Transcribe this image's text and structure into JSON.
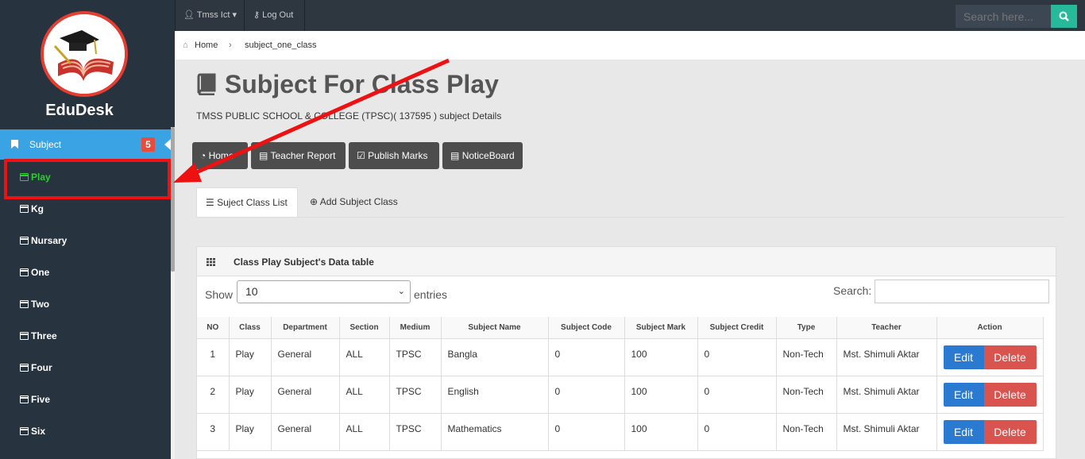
{
  "sidebar": {
    "brand": "EduDesk",
    "active_item": {
      "label": "Subject",
      "badge": "5"
    },
    "items": [
      {
        "label": "Play",
        "selected": true
      },
      {
        "label": "Kg"
      },
      {
        "label": "Nursary"
      },
      {
        "label": "One"
      },
      {
        "label": "Two"
      },
      {
        "label": "Three"
      },
      {
        "label": "Four"
      },
      {
        "label": "Five"
      },
      {
        "label": "Six"
      }
    ]
  },
  "topbar": {
    "user": "Tmss Ict",
    "logout": "Log Out",
    "search_placeholder": "Search here..."
  },
  "breadcrumb": {
    "home": "Home",
    "current": "subject_one_class"
  },
  "page": {
    "title": "Subject For Class Play",
    "subtitle": "TMSS PUBLIC SCHOOL & COLLEGE (TPSC)( 137595 ) subject Details"
  },
  "quick_buttons": {
    "home": "Home",
    "teacher_report": "Teacher Report",
    "publish_marks": "Publish Marks",
    "noticeboard": "NoticeBoard"
  },
  "tabs": {
    "list": "Suject Class List",
    "add": "Add Subject Class"
  },
  "panel": {
    "title": "Class Play Subject's Data table",
    "show_label": "Show",
    "page_size": "10",
    "entries_label": "entries",
    "search_label": "Search:"
  },
  "table": {
    "headers": [
      "NO",
      "Class",
      "Department",
      "Section",
      "Medium",
      "Subject Name",
      "Subject Code",
      "Subject Mark",
      "Subject Credit",
      "Type",
      "Teacher",
      "Action"
    ],
    "rows": [
      [
        "1",
        "Play",
        "General",
        "ALL",
        "TPSC",
        "Bangla",
        "0",
        "100",
        "0",
        "Non-Tech",
        "Mst. Shimuli Aktar"
      ],
      [
        "2",
        "Play",
        "General",
        "ALL",
        "TPSC",
        "English",
        "0",
        "100",
        "0",
        "Non-Tech",
        "Mst. Shimuli Aktar"
      ],
      [
        "3",
        "Play",
        "General",
        "ALL",
        "TPSC",
        "Mathematics",
        "0",
        "100",
        "0",
        "Non-Tech",
        "Mst. Shimuli Aktar"
      ]
    ],
    "edit_label": "Edit",
    "delete_label": "Delete"
  }
}
